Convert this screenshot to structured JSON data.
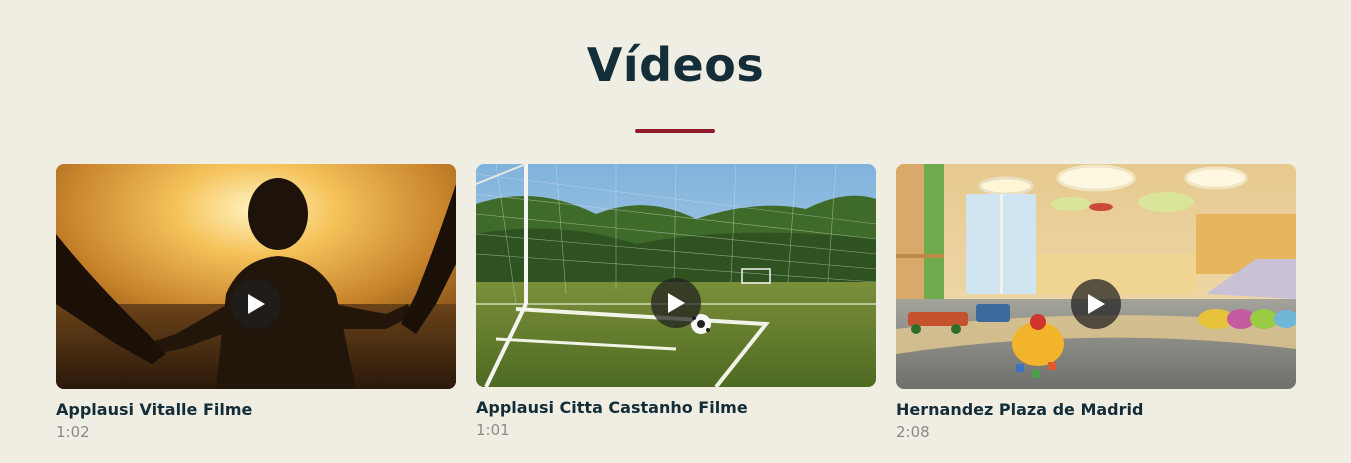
{
  "section": {
    "title": "Vídeos"
  },
  "colors": {
    "background": "#f0ede3",
    "title": "#132e39",
    "accent": "#8e1a2c",
    "duration": "#8b8b87"
  },
  "videos": [
    {
      "title": "Applausi Vitalle Filme",
      "duration": "1:02",
      "icon": "play-icon"
    },
    {
      "title": "Applausi Citta Castanho Filme",
      "duration": "1:01",
      "icon": "play-icon"
    },
    {
      "title": "Hernandez Plaza de Madrid",
      "duration": "2:08",
      "icon": "play-icon"
    }
  ]
}
